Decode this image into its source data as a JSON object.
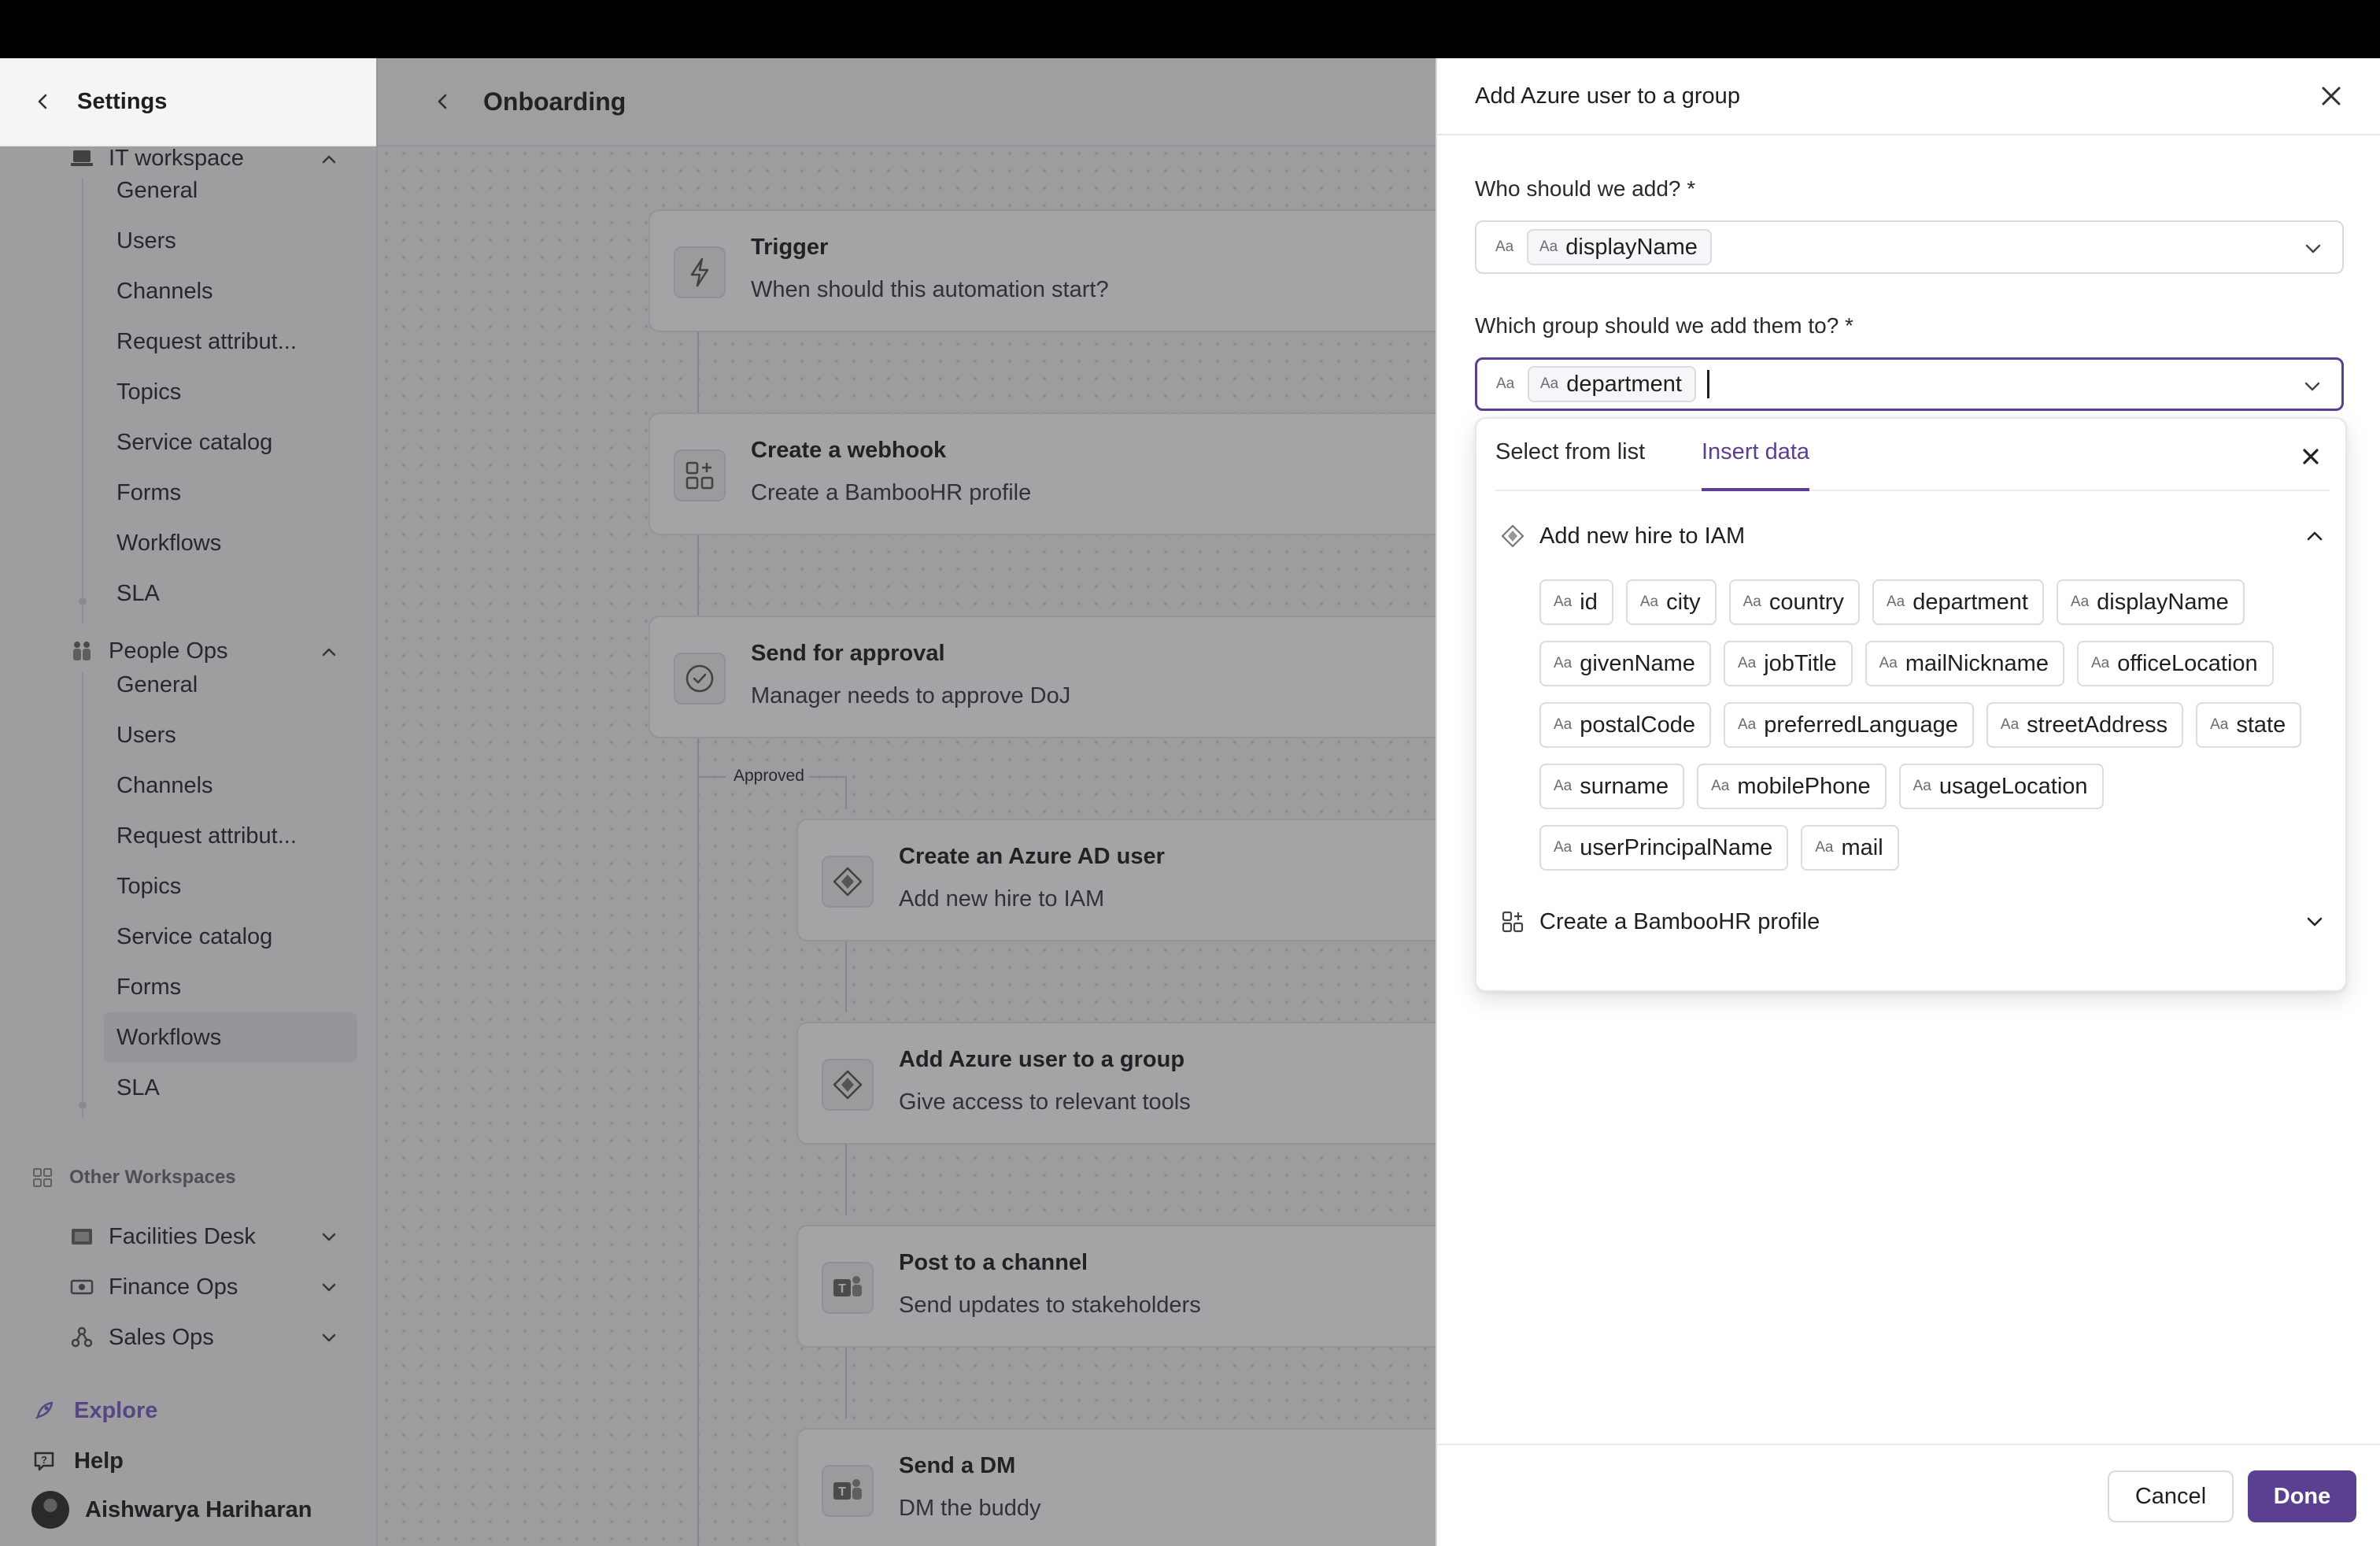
{
  "colors": {
    "accent": "#5b3f91",
    "explore": "#7c5cc4"
  },
  "sidebar": {
    "title": "Settings",
    "it_workspace": {
      "label": "IT workspace"
    },
    "it_items": [
      {
        "label": "General"
      },
      {
        "label": "Users"
      },
      {
        "label": "Channels"
      },
      {
        "label": "Request attribut..."
      },
      {
        "label": "Topics"
      },
      {
        "label": "Service catalog"
      },
      {
        "label": "Forms"
      },
      {
        "label": "Workflows"
      },
      {
        "label": "SLA"
      }
    ],
    "people_ops": {
      "label": "People Ops"
    },
    "people_items": [
      {
        "label": "General"
      },
      {
        "label": "Users"
      },
      {
        "label": "Channels"
      },
      {
        "label": "Request attribut..."
      },
      {
        "label": "Topics"
      },
      {
        "label": "Service catalog"
      },
      {
        "label": "Forms"
      },
      {
        "label": "Workflows",
        "active": true
      },
      {
        "label": "SLA"
      }
    ],
    "other_workspaces_title": "Other Workspaces",
    "other_workspaces": [
      {
        "label": "Facilities Desk",
        "icon": "building-icon"
      },
      {
        "label": "Finance Ops",
        "icon": "banknote-icon"
      },
      {
        "label": "Sales Ops",
        "icon": "nodes-icon"
      }
    ],
    "explore": "Explore",
    "help": "Help",
    "user_name": "Aishwarya Hariharan"
  },
  "canvas": {
    "title": "Onboarding",
    "nodes": [
      {
        "title": "Trigger",
        "subtitle": "When should this automation start?",
        "icon": "lightning-icon"
      },
      {
        "title": "Create a webhook",
        "subtitle": "Create a BambooHR profile",
        "icon": "webhook-icon"
      },
      {
        "title": "Send for approval",
        "subtitle": "Manager needs to approve DoJ",
        "icon": "check-circle-icon"
      },
      {
        "title": "Create an Azure AD user",
        "subtitle": "Add new hire to IAM",
        "icon": "azure-icon"
      },
      {
        "title": "Add Azure user to a group",
        "subtitle": "Give access to relevant tools",
        "icon": "azure-icon"
      },
      {
        "title": "Post to a channel",
        "subtitle": "Send updates to stakeholders",
        "icon": "teams-icon"
      },
      {
        "title": "Send a DM",
        "subtitle": "DM the buddy",
        "icon": "teams-icon"
      }
    ],
    "approved_label": "Approved"
  },
  "drawer": {
    "title": "Add Azure user to a group",
    "field1": {
      "label": "Who should we add? *",
      "aa": "Aa",
      "value": "displayName"
    },
    "field2": {
      "label": "Which group should we add them to? *",
      "aa": "Aa",
      "value": "department"
    },
    "popover": {
      "tab_list": "Select from list",
      "tab_insert": "Insert data",
      "group1": {
        "label": "Add new hire to IAM",
        "fields": [
          "id",
          "city",
          "country",
          "department",
          "displayName",
          "givenName",
          "jobTitle",
          "mailNickname",
          "officeLocation",
          "postalCode",
          "preferredLanguage",
          "streetAddress",
          "state",
          "surname",
          "mobilePhone",
          "usageLocation",
          "userPrincipalName",
          "mail"
        ]
      },
      "group2": {
        "label": "Create a BambooHR profile"
      },
      "aa": "Aa"
    },
    "cancel": "Cancel",
    "done": "Done"
  }
}
